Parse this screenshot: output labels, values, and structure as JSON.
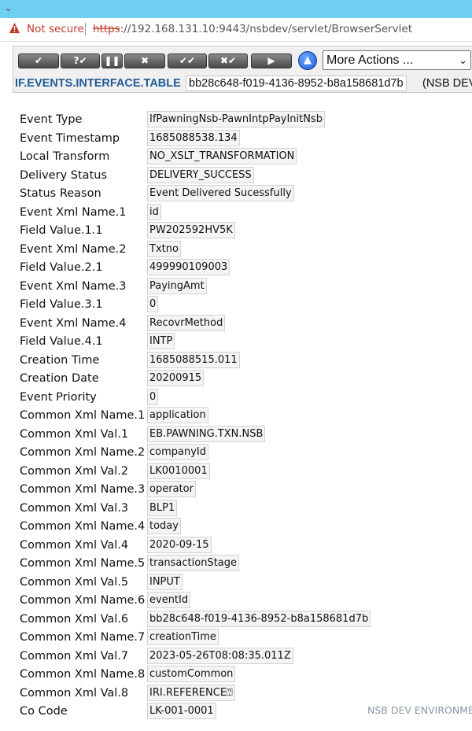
{
  "browser": {
    "not_secure": "Not secure",
    "url_scheme": "https",
    "url_rest": "://192.168.131.10:9443/nsbdev/servlet/BrowserServlet"
  },
  "toolbar": {
    "buttons": [
      {
        "name": "commit-button",
        "label": "✔"
      },
      {
        "name": "validate-button",
        "label": "?✔"
      },
      {
        "name": "hold-button",
        "label": "❚❚"
      },
      {
        "name": "delete-button",
        "label": "✖"
      },
      {
        "name": "authorise-button",
        "label": "✔✔"
      },
      {
        "name": "reverse-button",
        "label": "✖✔"
      },
      {
        "name": "next-button",
        "label": "▶"
      }
    ],
    "up_label": "▲",
    "more_actions": "More Actions ...",
    "more_actions_arrow": "⌄"
  },
  "header": {
    "table_name": "IF.EVENTS.INTERFACE.TABLE",
    "record_id": "bb28c648-f019-4136-8952-b8a158681d7b",
    "environment": "(NSB DEV"
  },
  "fields": [
    {
      "label": "Event Type",
      "value": "IfPawningNsb-PawnIntpPayInitNsb"
    },
    {
      "label": "Event Timestamp",
      "value": "1685088538.134"
    },
    {
      "label": "Local Transform",
      "value": "NO_XSLT_TRANSFORMATION"
    },
    {
      "label": "Delivery Status",
      "value": "DELIVERY_SUCCESS"
    },
    {
      "label": "Status Reason",
      "value": "Event Delivered Sucessfully"
    },
    {
      "label": "Event Xml Name.1",
      "value": "id"
    },
    {
      "label": "Field Value.1.1",
      "value": "PW202592HV5K"
    },
    {
      "label": "Event Xml Name.2",
      "value": "Txtno"
    },
    {
      "label": "Field Value.2.1",
      "value": "499990109003"
    },
    {
      "label": "Event Xml Name.3",
      "value": "PayingAmt"
    },
    {
      "label": "Field Value.3.1",
      "value": "0"
    },
    {
      "label": "Event Xml Name.4",
      "value": "RecovrMethod"
    },
    {
      "label": "Field Value.4.1",
      "value": "INTP"
    },
    {
      "label": "Creation Time",
      "value": "1685088515.011"
    },
    {
      "label": "Creation Date",
      "value": "20200915"
    },
    {
      "label": "Event Priority",
      "value": "0"
    },
    {
      "label": "Common Xml Name.1",
      "value": "application"
    },
    {
      "label": "Common Xml Val.1",
      "value": "EB.PAWNING.TXN.NSB"
    },
    {
      "label": "Common Xml Name.2",
      "value": "companyId"
    },
    {
      "label": "Common Xml Val.2",
      "value": "LK0010001"
    },
    {
      "label": "Common Xml Name.3",
      "value": "operator"
    },
    {
      "label": "Common Xml Val.3",
      "value": "BLP1"
    },
    {
      "label": "Common Xml Name.4",
      "value": "today"
    },
    {
      "label": "Common Xml Val.4",
      "value": "2020-09-15"
    },
    {
      "label": "Common Xml Name.5",
      "value": "transactionStage"
    },
    {
      "label": "Common Xml Val.5",
      "value": "INPUT"
    },
    {
      "label": "Common Xml Name.6",
      "value": "eventId"
    },
    {
      "label": "Common Xml Val.6",
      "value": "bb28c648-f019-4136-8952-b8a158681d7b"
    },
    {
      "label": "Common Xml Name.7",
      "value": "creationTime"
    },
    {
      "label": "Common Xml Val.7",
      "value": "2023-05-26T08:08:35.011Z"
    },
    {
      "label": "Common Xml Name.8",
      "value": "customCommon"
    },
    {
      "label": "Common Xml Val.8",
      "value": "IRI.REFERENCE⍰"
    },
    {
      "label": "Co Code",
      "value": "LK-001-0001"
    }
  ],
  "footer": {
    "environment": "NSB DEV ENVIRONMENT"
  }
}
